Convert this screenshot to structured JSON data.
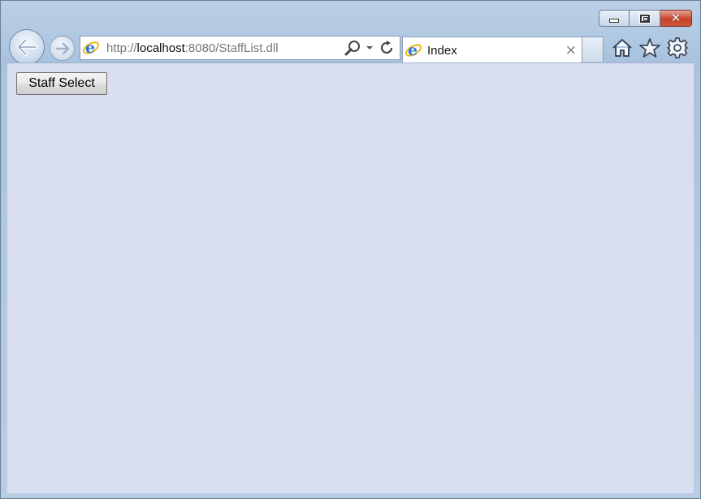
{
  "browser": {
    "address": {
      "url_prefix": "http://",
      "url_host": "localhost",
      "url_rest": ":8080/StaffList.dll"
    },
    "tab": {
      "title": "Index",
      "close_glyph": "×"
    },
    "caption": {
      "close_glyph": "✕"
    },
    "icons": [
      "back-arrow-icon",
      "forward-arrow-icon",
      "ie-logo-icon",
      "search-icon",
      "dropdown-icon",
      "refresh-icon",
      "home-icon",
      "favorites-star-icon",
      "settings-gear-icon"
    ]
  },
  "page": {
    "staff_select_label": "Staff Select"
  },
  "colors": {
    "content_background": "#d9dff0",
    "frame": "#b8cde3",
    "close_button": "#c7432a"
  }
}
